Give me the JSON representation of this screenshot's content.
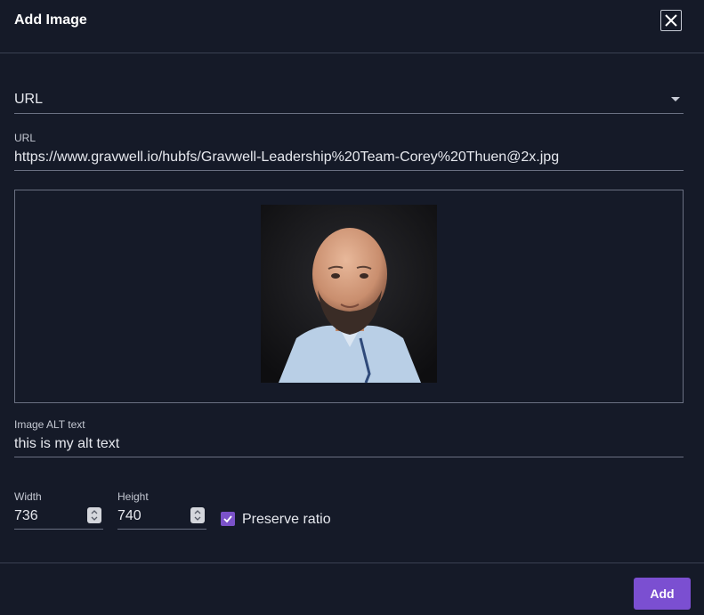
{
  "dialog": {
    "title": "Add Image",
    "close_icon": "close-icon"
  },
  "source": {
    "selected": "URL"
  },
  "url_field": {
    "label": "URL",
    "value": "https://www.gravwell.io/hubfs/Gravwell-Leadership%20Team-Corey%20Thuen@2x.jpg"
  },
  "preview": {
    "alt": "this is my alt text"
  },
  "alt_field": {
    "label": "Image ALT text",
    "value": "this is my alt text"
  },
  "width_field": {
    "label": "Width",
    "value": "736"
  },
  "height_field": {
    "label": "Height",
    "value": "740"
  },
  "preserve_ratio": {
    "label": "Preserve ratio",
    "checked": true
  },
  "footer": {
    "add_label": "Add"
  },
  "colors": {
    "background": "#151a28",
    "accent": "#7b4fd1",
    "divider": "#3a4052"
  }
}
